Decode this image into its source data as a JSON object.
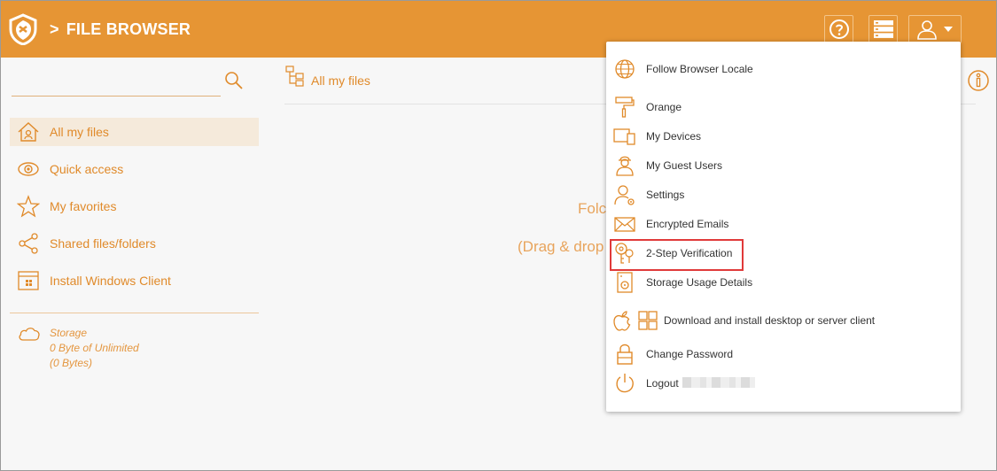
{
  "header": {
    "separator": ">",
    "title": "FILE BROWSER",
    "icons": [
      "shield-logo-icon",
      "help-icon",
      "server-icon",
      "user-icon",
      "caret-down-icon"
    ]
  },
  "sidebar": {
    "items": [
      {
        "label": "All my files",
        "icon": "home-icon",
        "active": true
      },
      {
        "label": "Quick access",
        "icon": "eye-icon"
      },
      {
        "label": "My favorites",
        "icon": "star-icon"
      },
      {
        "label": "Shared files/folders",
        "icon": "share-icon"
      },
      {
        "label": "Install Windows Client",
        "icon": "windows-client-icon"
      }
    ],
    "storage": {
      "title": "Storage",
      "usage": "0 Byte of Unlimited",
      "bytes": "(0 Bytes)"
    }
  },
  "main": {
    "title": "All my files",
    "empty_line1": "Folc",
    "empty_line2": "(Drag & drop"
  },
  "menu": {
    "items": [
      {
        "label": "Follow Browser Locale",
        "icon": "globe-icon"
      },
      {
        "label": "Orange",
        "icon": "paint-roller-icon"
      },
      {
        "label": "My Devices",
        "icon": "devices-icon"
      },
      {
        "label": "My Guest Users",
        "icon": "guest-user-icon"
      },
      {
        "label": "Settings",
        "icon": "user-settings-icon"
      },
      {
        "label": "Encrypted Emails",
        "icon": "envelope-icon"
      },
      {
        "label": "2-Step Verification",
        "icon": "key-icon",
        "highlighted": true
      },
      {
        "label": "Storage Usage Details",
        "icon": "storage-disk-icon"
      },
      {
        "label": "Download and install desktop or server client",
        "icon": "apple-windows-icon"
      },
      {
        "label": "Change Password",
        "icon": "lock-icon"
      },
      {
        "label": "Logout",
        "icon": "power-icon"
      }
    ]
  },
  "colors": {
    "brand": "#e69534",
    "accent_text": "#e08a2a",
    "highlight": "#e03a3a"
  }
}
